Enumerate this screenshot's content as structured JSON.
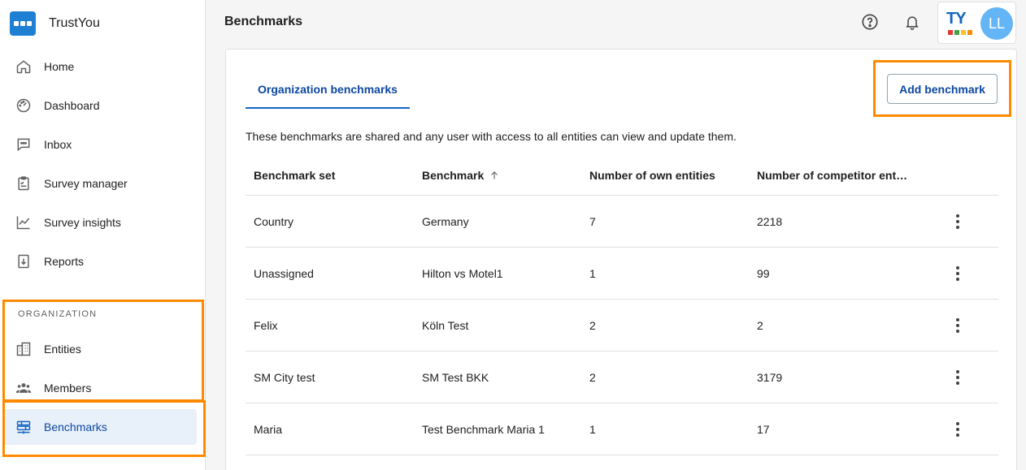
{
  "app": {
    "name": "TrustYou"
  },
  "sidebar": {
    "items": [
      {
        "label": "Home",
        "icon": "home-icon"
      },
      {
        "label": "Dashboard",
        "icon": "dashboard-icon"
      },
      {
        "label": "Inbox",
        "icon": "inbox-icon"
      },
      {
        "label": "Survey manager",
        "icon": "clipboard-icon"
      },
      {
        "label": "Survey insights",
        "icon": "chart-line-icon"
      },
      {
        "label": "Reports",
        "icon": "report-download-icon"
      }
    ],
    "section_label": "ORGANIZATION",
    "org_items": [
      {
        "label": "Entities",
        "icon": "entities-icon"
      },
      {
        "label": "Members",
        "icon": "members-icon"
      },
      {
        "label": "Benchmarks",
        "icon": "benchmarks-icon",
        "active": true
      }
    ]
  },
  "header": {
    "title": "Benchmarks",
    "avatar_initials": "LL",
    "logo_text": "TY"
  },
  "main": {
    "tab_label": "Organization benchmarks",
    "add_button_label": "Add benchmark",
    "description": "These benchmarks are shared and any user with access to all entities can view and update them.",
    "table": {
      "columns": [
        "Benchmark set",
        "Benchmark",
        "Number of own entities",
        "Number of competitor entit…"
      ],
      "rows": [
        [
          "Country",
          "Germany",
          "7",
          "2218"
        ],
        [
          "Unassigned",
          "Hilton vs Motel1",
          "1",
          "99"
        ],
        [
          "Felix",
          "Köln Test",
          "2",
          "2"
        ],
        [
          "SM City test",
          "SM Test BKK",
          "2",
          "3179"
        ],
        [
          "Maria",
          "Test Benchmark Maria 1",
          "1",
          "17"
        ]
      ]
    }
  },
  "colors": {
    "accent": "#1565c0",
    "highlight": "#ff8a00",
    "active_bg": "#e8f0fa",
    "avatar": "#64b5f6"
  }
}
